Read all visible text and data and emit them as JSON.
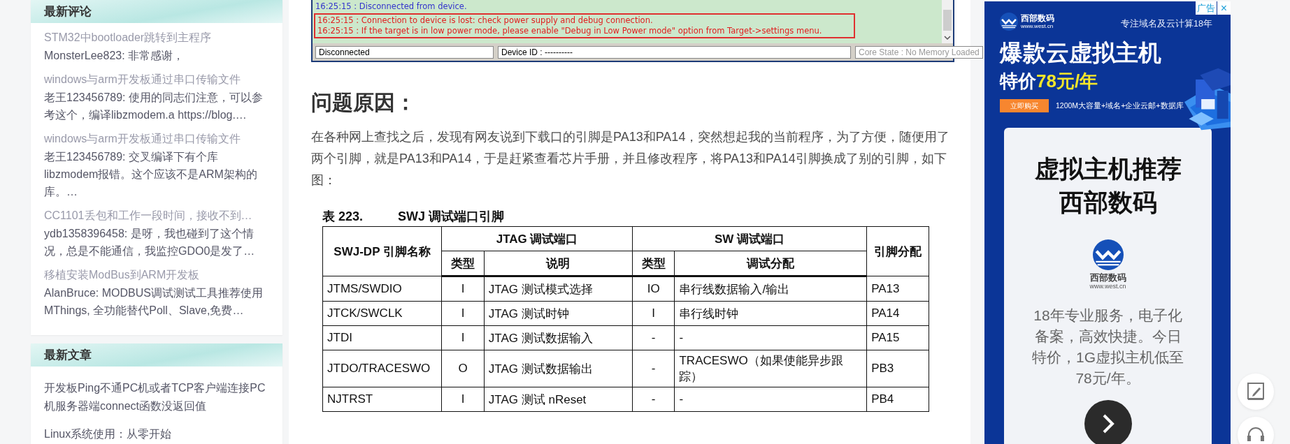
{
  "sidebar": {
    "cards": [
      {
        "title": "最新评论",
        "kind": "comments",
        "items": [
          {
            "title": "STM32中bootloader跳转到主程序",
            "text": "MonsterLee823: 非常感谢，"
          },
          {
            "title": "windows与arm开发板通过串口传输文件",
            "text": "老王123456789: 使用的同志们注意，可以参考这个，编译libzmodem.a https://blog.…"
          },
          {
            "title": "windows与arm开发板通过串口传输文件",
            "text": "老王123456789: 交叉编译下有个库 libzmodem报错。这个应该不是ARM架构的库。…"
          },
          {
            "title": "CC1101丢包和工作一段时间，接收不到…",
            "text": "ydb1358396458: 是呀，我也碰到了这个情况，总是不能通信，我监控GDO0是发了…"
          },
          {
            "title": "移植安装ModBus到ARM开发板",
            "text": "AlanBruce: MODBUS调试测试工具推荐使用MThings, 全功能替代Poll、Slave,免费…"
          }
        ]
      },
      {
        "title": "最新文章",
        "kind": "articles",
        "items": [
          {
            "title": "开发板Ping不通PC机或者TCP客户端连接PC机服务器端connect函数没返回值"
          },
          {
            "title": "Linux系统使用：从零开始"
          }
        ]
      }
    ]
  },
  "article": {
    "log": {
      "lines": [
        {
          "text": "16:25:15 : Disconnected from device.",
          "kind": "info"
        },
        {
          "text": "16:25:15 : Connection to device is lost: check power supply and debug connection.",
          "kind": "error"
        },
        {
          "text": "16:25:15 : If the target is in low power mode, please enable \"Debug in Low Power mode\" option from Target->settings menu.",
          "kind": "error"
        }
      ],
      "status": [
        {
          "text": "Disconnected",
          "disabled": false
        },
        {
          "text": "Device ID : ----------",
          "disabled": false
        },
        {
          "text": "Core State : No Memory Loaded",
          "disabled": true
        }
      ]
    },
    "heading": "问题原因：",
    "paragraph": "在各种网上查找之后，发现有网友说到下载口的引脚是PA13和PA14，突然想起我的当前程序，为了方便，随便用了两个引脚，就是PA13和PA14，于是赶紧查看芯片手册，并且修改程序，将PA13和PA14引脚换成了别的引脚，如下图：",
    "table": {
      "caption_number": "表 223.",
      "caption_title": "SWJ 调试端口引脚",
      "first_header": "SWJ-DP 引脚名称",
      "group_headers": [
        "JTAG 调试端口",
        "SW 调试端口"
      ],
      "last_header": "引脚分配",
      "sub_headers": [
        "类型",
        "说明",
        "类型",
        "调试分配"
      ],
      "rows": [
        [
          "JTMS/SWDIO",
          "I",
          "JTAG 测试模式选择",
          "IO",
          "串行线数据输入/输出",
          "PA13"
        ],
        [
          "JTCK/SWCLK",
          "I",
          "JTAG 测试时钟",
          "I",
          "串行线时钟",
          "PA14"
        ],
        [
          "JTDI",
          "I",
          "JTAG 测试数据输入",
          "-",
          "-",
          "PA15"
        ],
        [
          "JTDO/TRACESWO",
          "O",
          "JTAG 测试数据输出",
          "-",
          "TRACESWO（如果使能异步跟踪）",
          "PB3"
        ],
        [
          "NJTRST",
          "I",
          "JTAG 测试 nReset",
          "-",
          "-",
          "PB4"
        ]
      ]
    }
  },
  "ad": {
    "label": "广告",
    "close": "×",
    "brand": "西部数码",
    "domain": "www.west.cn",
    "slogan": "专注域名及云计算18年",
    "headline": "爆款云虚拟主机",
    "price_prefix": "特价",
    "price": "78元/年",
    "buy": "立即购买",
    "features": "1200M大容量+域名+企业云邮+数据库",
    "card_title": [
      "虚拟主机推荐",
      "西部数码"
    ],
    "card_brand": "西部数码",
    "card_domain": "www.west.cn",
    "card_text": "18年专业服务，电子化备案，高效快捷。今日特价，1G虚拟主机低至78元/年。"
  }
}
